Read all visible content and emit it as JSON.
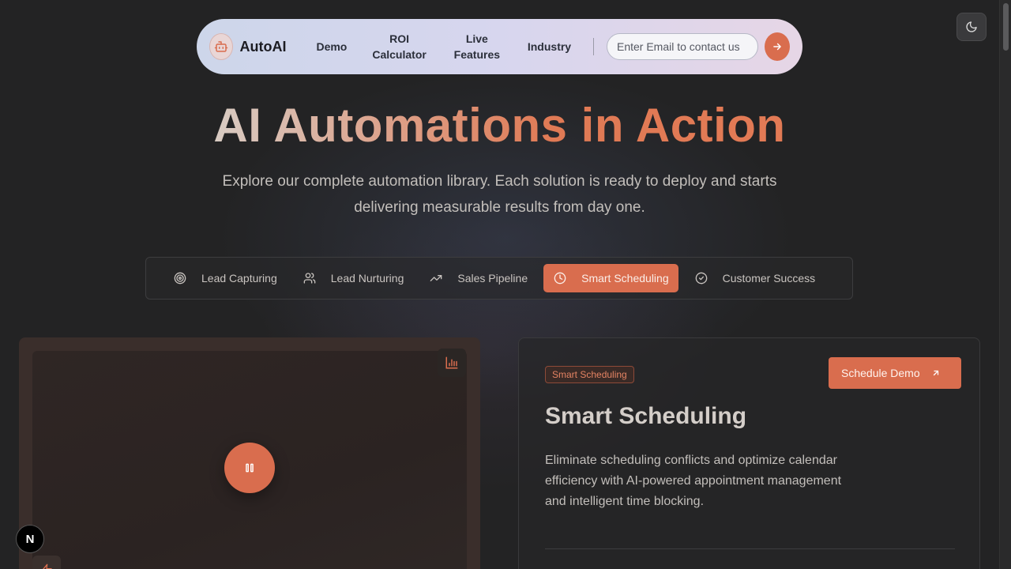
{
  "brand": {
    "name": "AutoAI",
    "icon": "robot-icon"
  },
  "nav": {
    "links": [
      "Demo",
      "ROI Calculator",
      "Live Features",
      "Industry"
    ],
    "email_placeholder": "Enter Email to contact us",
    "send_icon": "arrow-right-icon",
    "theme_icon": "moon-icon"
  },
  "hero": {
    "title": "AI Automations in Action",
    "subtitle": "Explore our complete automation library. Each solution is ready to deploy and starts delivering measurable results from day one."
  },
  "tabs": [
    {
      "label": "Lead Capturing",
      "icon": "target-icon",
      "active": false
    },
    {
      "label": "Lead Nurturing",
      "icon": "users-icon",
      "active": false
    },
    {
      "label": "Sales Pipeline",
      "icon": "trending-up-icon",
      "active": false
    },
    {
      "label": "Smart Scheduling",
      "icon": "clock-icon",
      "active": true
    },
    {
      "label": "Customer Success",
      "icon": "check-circle-icon",
      "active": false
    }
  ],
  "detail": {
    "tag": "Smart Scheduling",
    "demo_button": "Schedule Demo",
    "title": "Smart Scheduling",
    "description": "Eliminate scheduling conflicts and optimize calendar efficiency with AI-powered appointment management and intelligent time blocking."
  },
  "overlay": {
    "next_badge": "N"
  },
  "colors": {
    "accent": "#d96d4e",
    "background": "#232324"
  }
}
